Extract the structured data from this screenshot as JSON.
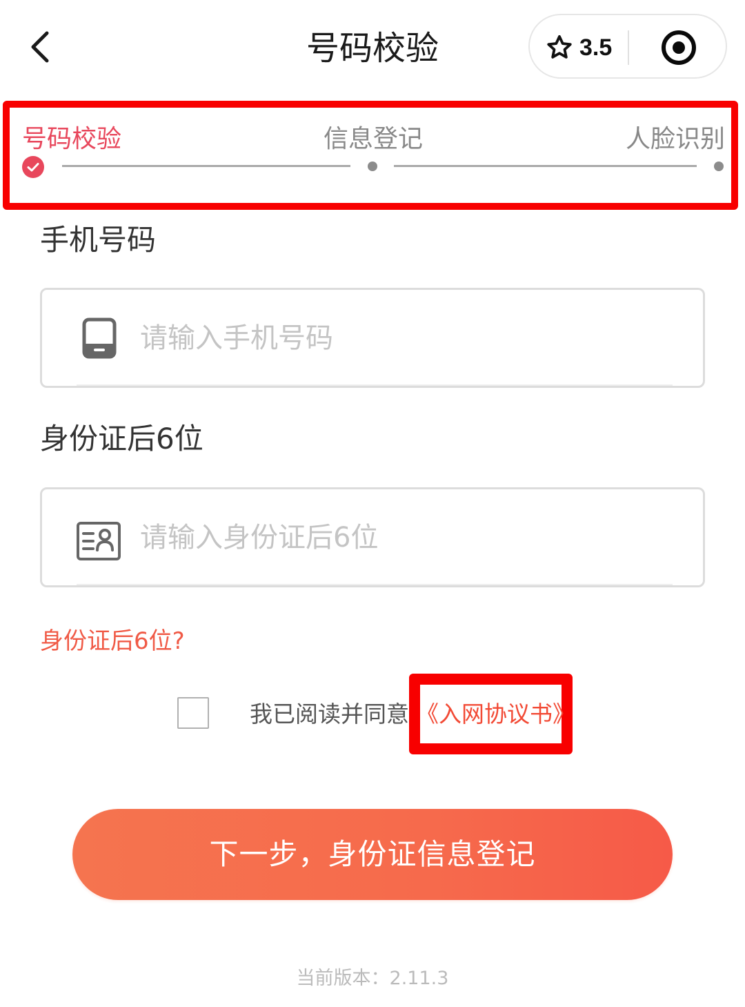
{
  "header": {
    "title": "号码校验",
    "back_icon": "chevron-left-icon",
    "rating_icon": "star-icon",
    "rating_value": "3.5",
    "target_icon": "target-icon"
  },
  "steps": [
    {
      "label": "号码校验",
      "state": "active"
    },
    {
      "label": "信息登记",
      "state": "pending"
    },
    {
      "label": "人脸识别",
      "state": "pending"
    }
  ],
  "colors": {
    "accent": "#e8475c",
    "link": "#f24a35",
    "highlight_border": "#f80000",
    "button_gradient_start": "#f5744f",
    "button_gradient_end": "#f65a48"
  },
  "form": {
    "phone": {
      "label": "手机号码",
      "placeholder": "请输入手机号码",
      "value": "",
      "icon": "phone-icon"
    },
    "idcard": {
      "label": "身份证后6位",
      "placeholder": "请输入身份证后6位",
      "value": "",
      "icon": "id-card-icon"
    },
    "hint_link": "身份证后6位?"
  },
  "agreement": {
    "checked": false,
    "text": "我已阅读并同意",
    "link": "《入网协议书》"
  },
  "next_button": {
    "label": "下一步，身份证信息登记"
  },
  "footer": {
    "version": "当前版本：2.11.3"
  }
}
